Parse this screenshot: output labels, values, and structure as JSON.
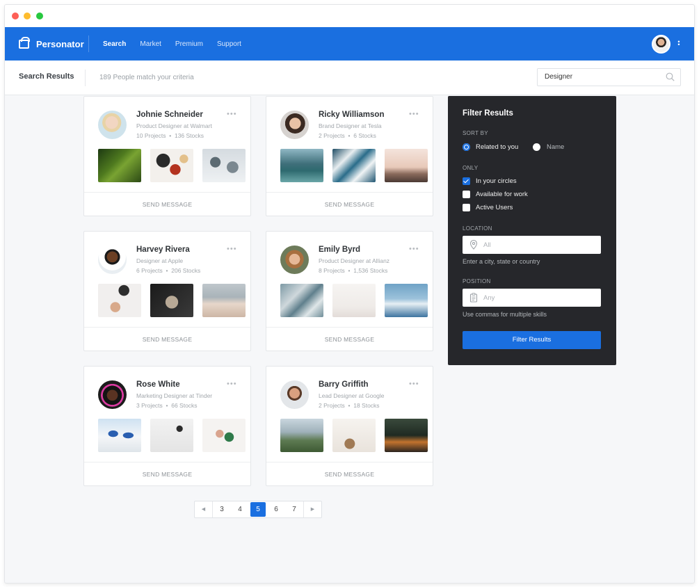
{
  "app": {
    "brand": "Personator"
  },
  "nav": {
    "items": [
      "Search",
      "Market",
      "Premium",
      "Support"
    ],
    "active": "Search"
  },
  "subheader": {
    "title": "Search Results",
    "count_text": "189 People match your criteria"
  },
  "search": {
    "value": "Designer"
  },
  "action_label": "SEND MESSAGE",
  "people": [
    {
      "name": "Johnie Schneider",
      "role": "Product Designer at Walmart",
      "projects": "10 Projects",
      "stocks": "136 Stocks"
    },
    {
      "name": "Ricky Williamson",
      "role": "Brand Designer at Tesla",
      "projects": "2 Projects",
      "stocks": "6 Stocks"
    },
    {
      "name": "Harvey Rivera",
      "role": "Designer at Apple",
      "projects": "6 Projects",
      "stocks": "206 Stocks"
    },
    {
      "name": "Emily Byrd",
      "role": "Product Designer at Allianz",
      "projects": "8 Projects",
      "stocks": "1,536 Stocks"
    },
    {
      "name": "Rose White",
      "role": "Marketing Designer at Tinder",
      "projects": "3 Projects",
      "stocks": "66 Stocks"
    },
    {
      "name": "Barry Griffith",
      "role": "Lead Designer at Google",
      "projects": "2 Projects",
      "stocks": "18 Stocks"
    }
  ],
  "pagination": {
    "pages": [
      "3",
      "4",
      "5",
      "6",
      "7"
    ],
    "current": "5"
  },
  "filter": {
    "title": "Filter Results",
    "sort_by_label": "SORT BY",
    "sort_options": [
      "Related to you",
      "Name"
    ],
    "sort_selected": "Related to you",
    "only_label": "ONLY",
    "only_options": [
      {
        "label": "In your circles",
        "checked": true
      },
      {
        "label": "Available for work",
        "checked": false
      },
      {
        "label": "Active Users",
        "checked": false
      }
    ],
    "location_label": "LOCATION",
    "location_placeholder": "All",
    "location_hint": "Enter a city, state or country",
    "position_label": "POSITION",
    "position_placeholder": "Any",
    "position_hint": "Use commas for multiple skills",
    "button_label": "Filter Results"
  },
  "colors": {
    "primary": "#1a6fe0",
    "panel": "#26272b",
    "background": "#f6f7f9"
  }
}
